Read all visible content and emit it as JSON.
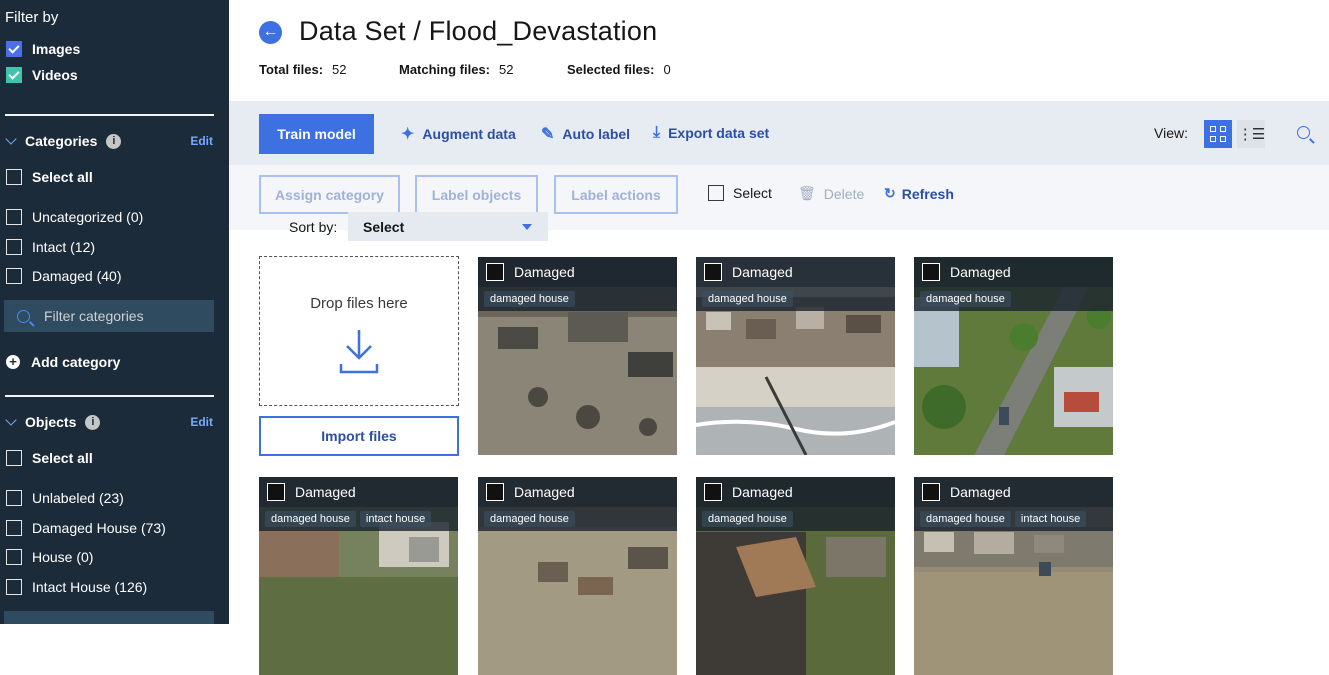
{
  "sidebar": {
    "title": "Filter by",
    "media": [
      {
        "label": "Images",
        "checked": true,
        "color": "#4b6fe8"
      },
      {
        "label": "Videos",
        "checked": true,
        "color": "#3ec5ae"
      }
    ],
    "categories": {
      "heading": "Categories",
      "edit": "Edit",
      "select_all": "Select all",
      "items": [
        "Uncategorized (0)",
        "Intact (12)",
        "Damaged (40)"
      ],
      "filter_placeholder": "Filter categories",
      "add": "Add category"
    },
    "objects": {
      "heading": "Objects",
      "edit": "Edit",
      "select_all": "Select all",
      "items": [
        "Unlabeled (23)",
        "Damaged House (73)",
        "House (0)",
        "Intact House (126)"
      ]
    }
  },
  "header": {
    "title": "Data Set / Flood_Devastation",
    "total_label": "Total files:",
    "total": "52",
    "matching_label": "Matching files:",
    "matching": "52",
    "selected_label": "Selected files:",
    "selected": "0"
  },
  "toolbar": {
    "train": "Train model",
    "augment": "Augment data",
    "auto_label": "Auto label",
    "export": "Export data set",
    "view_label": "View:"
  },
  "actions": {
    "assign": "Assign category",
    "label_objects": "Label objects",
    "label_actions": "Label actions",
    "select": "Select",
    "delete": "Delete",
    "refresh": "Refresh",
    "sort_label": "Sort by:",
    "sort_value": "Select"
  },
  "upload": {
    "drop": "Drop files here",
    "import": "Import files"
  },
  "cards": [
    {
      "category": "Damaged",
      "tags": [
        "damaged house"
      ],
      "scene": "flood-aerial"
    },
    {
      "category": "Damaged",
      "tags": [
        "damaged house"
      ],
      "scene": "beach-debris"
    },
    {
      "category": "Damaged",
      "tags": [
        "damaged house"
      ],
      "scene": "road-trees"
    },
    {
      "category": "Damaged",
      "tags": [
        "damaged house",
        "intact house"
      ],
      "scene": "houses-hill"
    },
    {
      "category": "Damaged",
      "tags": [
        "damaged house"
      ],
      "scene": "flood-houses"
    },
    {
      "category": "Damaged",
      "tags": [
        "damaged house"
      ],
      "scene": "roof-damage"
    },
    {
      "category": "Damaged",
      "tags": [
        "damaged house",
        "intact house"
      ],
      "scene": "flooded-street"
    }
  ]
}
